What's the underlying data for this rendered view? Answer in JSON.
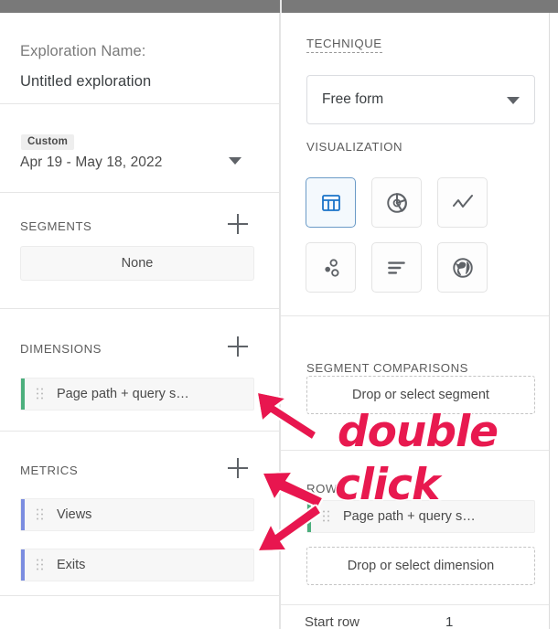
{
  "window": {
    "topbar_color": "#797979",
    "accent_green": "#4caf7d",
    "accent_blue": "#7b8de0",
    "annotation_color": "#e8194f"
  },
  "left_panel": {
    "exploration": {
      "label": "Exploration Name:",
      "name": "Untitled exploration"
    },
    "date_range": {
      "badge": "Custom",
      "value": "Apr 19 - May 18, 2022",
      "caret_icon": "chevron-down-icon"
    },
    "segments": {
      "title": "SEGMENTS",
      "add_icon": "plus-icon",
      "none_label": "None"
    },
    "dimensions": {
      "title": "DIMENSIONS",
      "add_icon": "plus-icon",
      "items": [
        {
          "label": "Page path + query s…",
          "grip_icon": "drag-handle-icon",
          "bar": "green"
        }
      ]
    },
    "metrics": {
      "title": "METRICS",
      "add_icon": "plus-icon",
      "items": [
        {
          "label": "Views",
          "grip_icon": "drag-handle-icon",
          "bar": "blue"
        },
        {
          "label": "Exits",
          "grip_icon": "drag-handle-icon",
          "bar": "blue"
        }
      ]
    }
  },
  "right_panel": {
    "technique": {
      "title": "TECHNIQUE",
      "selected": "Free form",
      "caret_icon": "chevron-down-icon"
    },
    "visualization": {
      "title": "VISUALIZATION",
      "options": [
        {
          "name": "free-form-table",
          "icon": "table-icon",
          "selected": true
        },
        {
          "name": "donut-chart",
          "icon": "donut-chart-icon",
          "selected": false
        },
        {
          "name": "line-chart",
          "icon": "line-chart-icon",
          "selected": false
        },
        {
          "name": "scatter-plot",
          "icon": "scatter-plot-icon",
          "selected": false
        },
        {
          "name": "bar-chart",
          "icon": "bar-chart-icon",
          "selected": false
        },
        {
          "name": "geo-map",
          "icon": "globe-icon",
          "selected": false
        }
      ]
    },
    "segment_comparisons": {
      "title": "SEGMENT COMPARISONS",
      "drop_label": "Drop or select segment"
    },
    "rows": {
      "title": "ROWS",
      "chip_label": "Page path + query s…",
      "chip_grip_icon": "drag-handle-icon",
      "drop_label": "Drop or select dimension",
      "start_row_label": "Start row",
      "start_row_value": "1"
    }
  },
  "annotations": {
    "line1": "double",
    "line2": "click",
    "arrows": [
      {
        "name": "arrow-to-dimension-chip"
      },
      {
        "name": "arrow-to-views-metric"
      },
      {
        "name": "arrow-to-exits-metric"
      }
    ]
  }
}
